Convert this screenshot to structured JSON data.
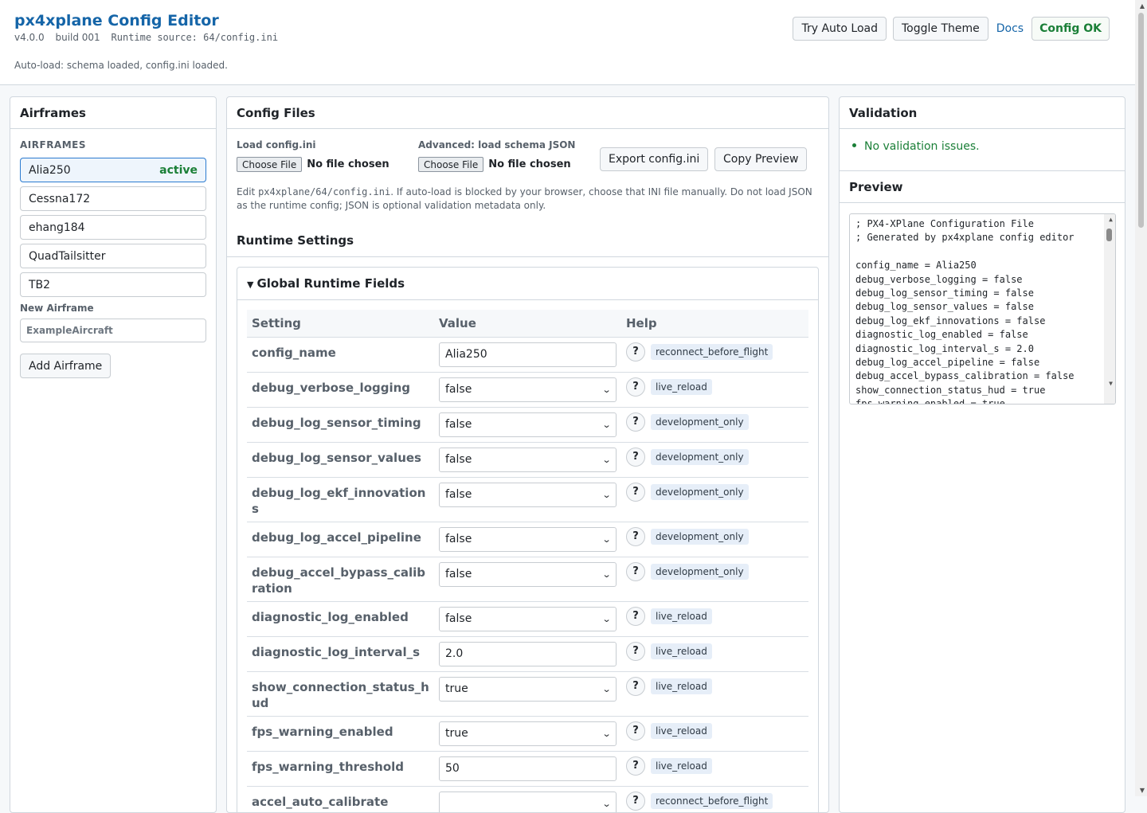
{
  "header": {
    "title": "px4xplane Config Editor",
    "version": "v4.0.0",
    "build": "build 001",
    "runtime_source": "Runtime source: 64/config.ini",
    "autoload_status": "Auto-load: schema loaded, config.ini loaded.",
    "try_auto_load": "Try Auto Load",
    "toggle_theme": "Toggle Theme",
    "docs": "Docs",
    "config_status": "Config OK"
  },
  "airframes": {
    "panel_title": "Airframes",
    "caption": "AIRFRAMES",
    "items": [
      {
        "label": "Alia250",
        "badge": "active"
      },
      {
        "label": "Cessna172"
      },
      {
        "label": "ehang184"
      },
      {
        "label": "QuadTailsitter"
      },
      {
        "label": "TB2"
      }
    ],
    "new_label": "New Airframe",
    "new_placeholder": "ExampleAircraft",
    "add_button": "Add Airframe"
  },
  "config_files": {
    "panel_title": "Config Files",
    "load_label": "Load config.ini",
    "schema_label": "Advanced: load schema JSON",
    "choose_file": "Choose File",
    "no_file": "No file chosen",
    "export_button": "Export config.ini",
    "copy_button": "Copy Preview",
    "help_pre": "Edit ",
    "help_path": "px4xplane/64/config.ini",
    "help_post": ". If auto-load is blocked by your browser, choose that INI file manually. Do not load JSON as the runtime config; JSON is optional validation metadata only.",
    "runtime_title": "Runtime Settings",
    "group_title": "Global Runtime Fields",
    "columns": {
      "setting": "Setting",
      "value": "Value",
      "help": "Help"
    },
    "rows": [
      {
        "name": "config_name",
        "value": "Alia250",
        "kind": "text",
        "tag": "reconnect_before_flight"
      },
      {
        "name": "debug_verbose_logging",
        "value": "false",
        "kind": "select",
        "tag": "live_reload"
      },
      {
        "name": "debug_log_sensor_timing",
        "value": "false",
        "kind": "select",
        "tag": "development_only"
      },
      {
        "name": "debug_log_sensor_values",
        "value": "false",
        "kind": "select",
        "tag": "development_only"
      },
      {
        "name": "debug_log_ekf_innovations",
        "value": "false",
        "kind": "select",
        "tag": "development_only"
      },
      {
        "name": "debug_log_accel_pipeline",
        "value": "false",
        "kind": "select",
        "tag": "development_only"
      },
      {
        "name": "debug_accel_bypass_calibration",
        "value": "false",
        "kind": "select",
        "tag": "development_only"
      },
      {
        "name": "diagnostic_log_enabled",
        "value": "false",
        "kind": "select",
        "tag": "live_reload"
      },
      {
        "name": "diagnostic_log_interval_s",
        "value": "2.0",
        "kind": "text",
        "tag": "live_reload"
      },
      {
        "name": "show_connection_status_hud",
        "value": "true",
        "kind": "select",
        "tag": "live_reload"
      },
      {
        "name": "fps_warning_enabled",
        "value": "true",
        "kind": "select",
        "tag": "live_reload"
      },
      {
        "name": "fps_warning_threshold",
        "value": "50",
        "kind": "text",
        "tag": "live_reload"
      },
      {
        "name": "accel_auto_calibrate",
        "value": "",
        "kind": "select",
        "tag": "reconnect_before_flight"
      }
    ]
  },
  "validation": {
    "panel_title": "Validation",
    "message": "No validation issues."
  },
  "preview": {
    "title": "Preview",
    "text": "; PX4-XPlane Configuration File\n; Generated by px4xplane config editor\n\nconfig_name = Alia250\ndebug_verbose_logging = false\ndebug_log_sensor_timing = false\ndebug_log_sensor_values = false\ndebug_log_ekf_innovations = false\ndiagnostic_log_enabled = false\ndiagnostic_log_interval_s = 2.0\ndebug_log_accel_pipeline = false\ndebug_accel_bypass_calibration = false\nshow_connection_status_hud = true\nfps_warning_enabled = true"
  },
  "colors": {
    "accent": "#1565a8",
    "ok": "#1a7f37",
    "active_border": "#2b7bd0",
    "tag_bg": "#e6eef8"
  }
}
